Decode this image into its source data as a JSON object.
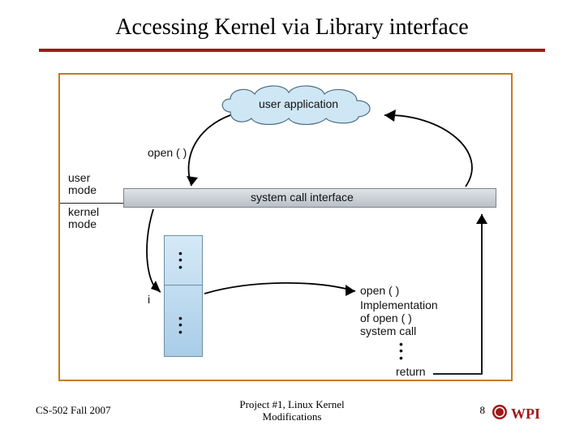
{
  "title": "Accessing Kernel via Library interface",
  "diagram": {
    "user_application": "user application",
    "open_left": "open ( )",
    "open_right": "open ( )",
    "user_mode": "user\nmode",
    "kernel_mode": "kernel\nmode",
    "system_call_interface": "system call interface",
    "i_label": "i",
    "implementation": "Implementation\nof open ( )\nsystem call",
    "return_label": "return",
    "dots_upper": "•\n•\n•",
    "dots_lower": "•\n•\n•",
    "dots_right": "•\n•\n•"
  },
  "footer": {
    "left": "CS-502 Fall 2007",
    "center": "Project #1, Linux Kernel\nModifications",
    "page": "8",
    "logo_text": "WPI"
  },
  "colors": {
    "accent": "#a11919",
    "frame": "#c77b19"
  }
}
